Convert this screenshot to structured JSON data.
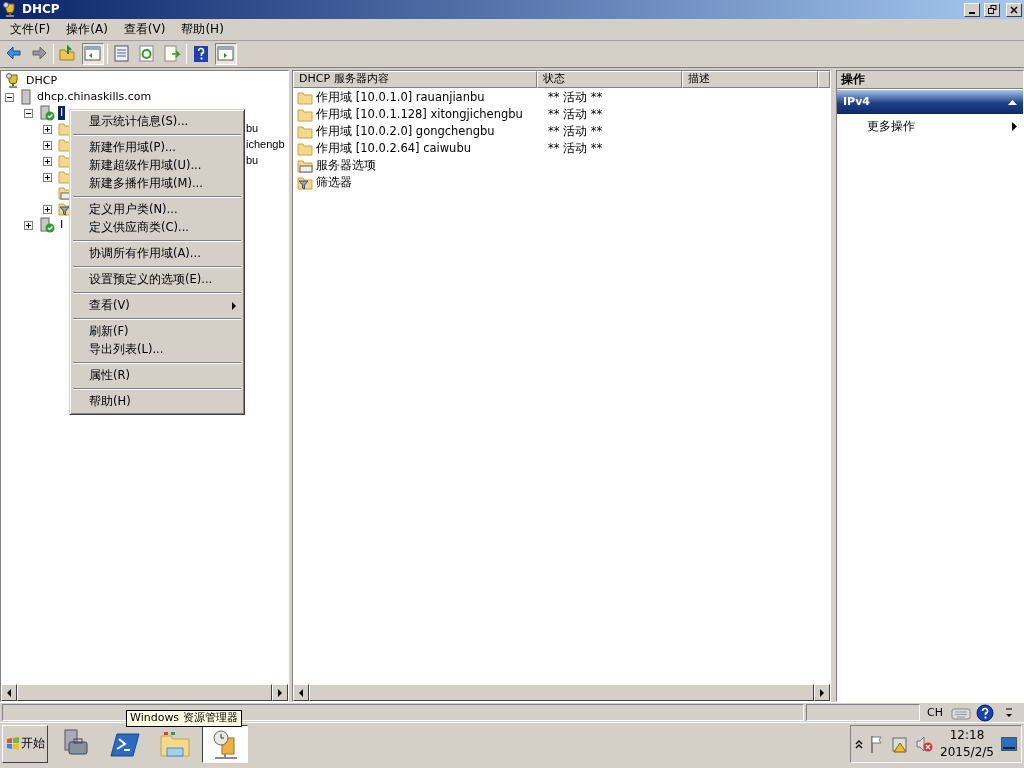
{
  "window": {
    "title": "DHCP"
  },
  "menu_bar": [
    "文件(F)",
    "操作(A)",
    "查看(V)",
    "帮助(H)"
  ],
  "tree": [
    {
      "label": "DHCP",
      "kind": "root",
      "children": [
        {
          "label": "dhcp.chinaskills.com",
          "kind": "server",
          "expanded": true,
          "children": [
            {
              "label": "I",
              "kind": "ipv",
              "expanded": true,
              "selected": true,
              "children": [
                {
                  "label": "bu",
                  "kind": "folder",
                  "expanded": false
                },
                {
                  "label": "ichengb",
                  "kind": "folder",
                  "expanded": false
                },
                {
                  "label": "bu",
                  "kind": "folder",
                  "expanded": false
                },
                {
                  "kind": "folder",
                  "expanded": false
                },
                {
                  "kind": "options"
                },
                {
                  "kind": "filter",
                  "expanded": false
                }
              ]
            },
            {
              "label": "I",
              "kind": "ipv",
              "expanded": false,
              "selected": false
            }
          ]
        }
      ]
    }
  ],
  "list": {
    "columns": [
      "DHCP 服务器内容",
      "状态",
      "描述"
    ],
    "rows": [
      {
        "kind": "folder",
        "name": "作用域 [10.0.1.0] rauanjianbu",
        "status": "** 活动 **"
      },
      {
        "kind": "folder",
        "name": "作用域 [10.0.1.128] xitongjichengbu",
        "status": "** 活动 **"
      },
      {
        "kind": "folder",
        "name": "作用域 [10.0.2.0] gongchengbu",
        "status": "** 活动 **"
      },
      {
        "kind": "folder",
        "name": "作用域 [10.0.2.64] caiwubu",
        "status": "** 活动 **"
      },
      {
        "kind": "options",
        "name": "服务器选项"
      },
      {
        "kind": "filter",
        "name": "筛选器"
      }
    ]
  },
  "actions": {
    "title": "操作",
    "section": {
      "label": "IPv4",
      "expanded": true
    },
    "items": [
      {
        "label": "更多操作",
        "submenu": true
      }
    ]
  },
  "context_menu": [
    [
      {
        "label": "显示统计信息(S)..."
      }
    ],
    [
      {
        "label": "新建作用域(P)..."
      },
      {
        "label": "新建超级作用域(U)..."
      },
      {
        "label": "新建多播作用域(M)..."
      }
    ],
    [
      {
        "label": "定义用户类(N)..."
      },
      {
        "label": "定义供应商类(C)..."
      }
    ],
    [
      {
        "label": "协调所有作用域(A)..."
      }
    ],
    [
      {
        "label": "设置预定义的选项(E)..."
      }
    ],
    [
      {
        "label": "查看(V)",
        "submenu": true
      }
    ],
    [
      {
        "label": "刷新(F)"
      },
      {
        "label": "导出列表(L)..."
      }
    ],
    [
      {
        "label": "属性(R)"
      }
    ],
    [
      {
        "label": "帮助(H)"
      }
    ]
  ],
  "language_bar": {
    "language": "CH"
  },
  "taskbar": {
    "start": "开始",
    "tooltip": "Windows 资源管理器",
    "apps": [
      {
        "kind": "server",
        "selected": false
      },
      {
        "kind": "shell",
        "selected": false
      },
      {
        "kind": "explorer",
        "selected": false
      },
      {
        "kind": "dhcp",
        "selected": true
      }
    ],
    "clock": {
      "time": "12:18",
      "date": "2015/2/5"
    }
  }
}
